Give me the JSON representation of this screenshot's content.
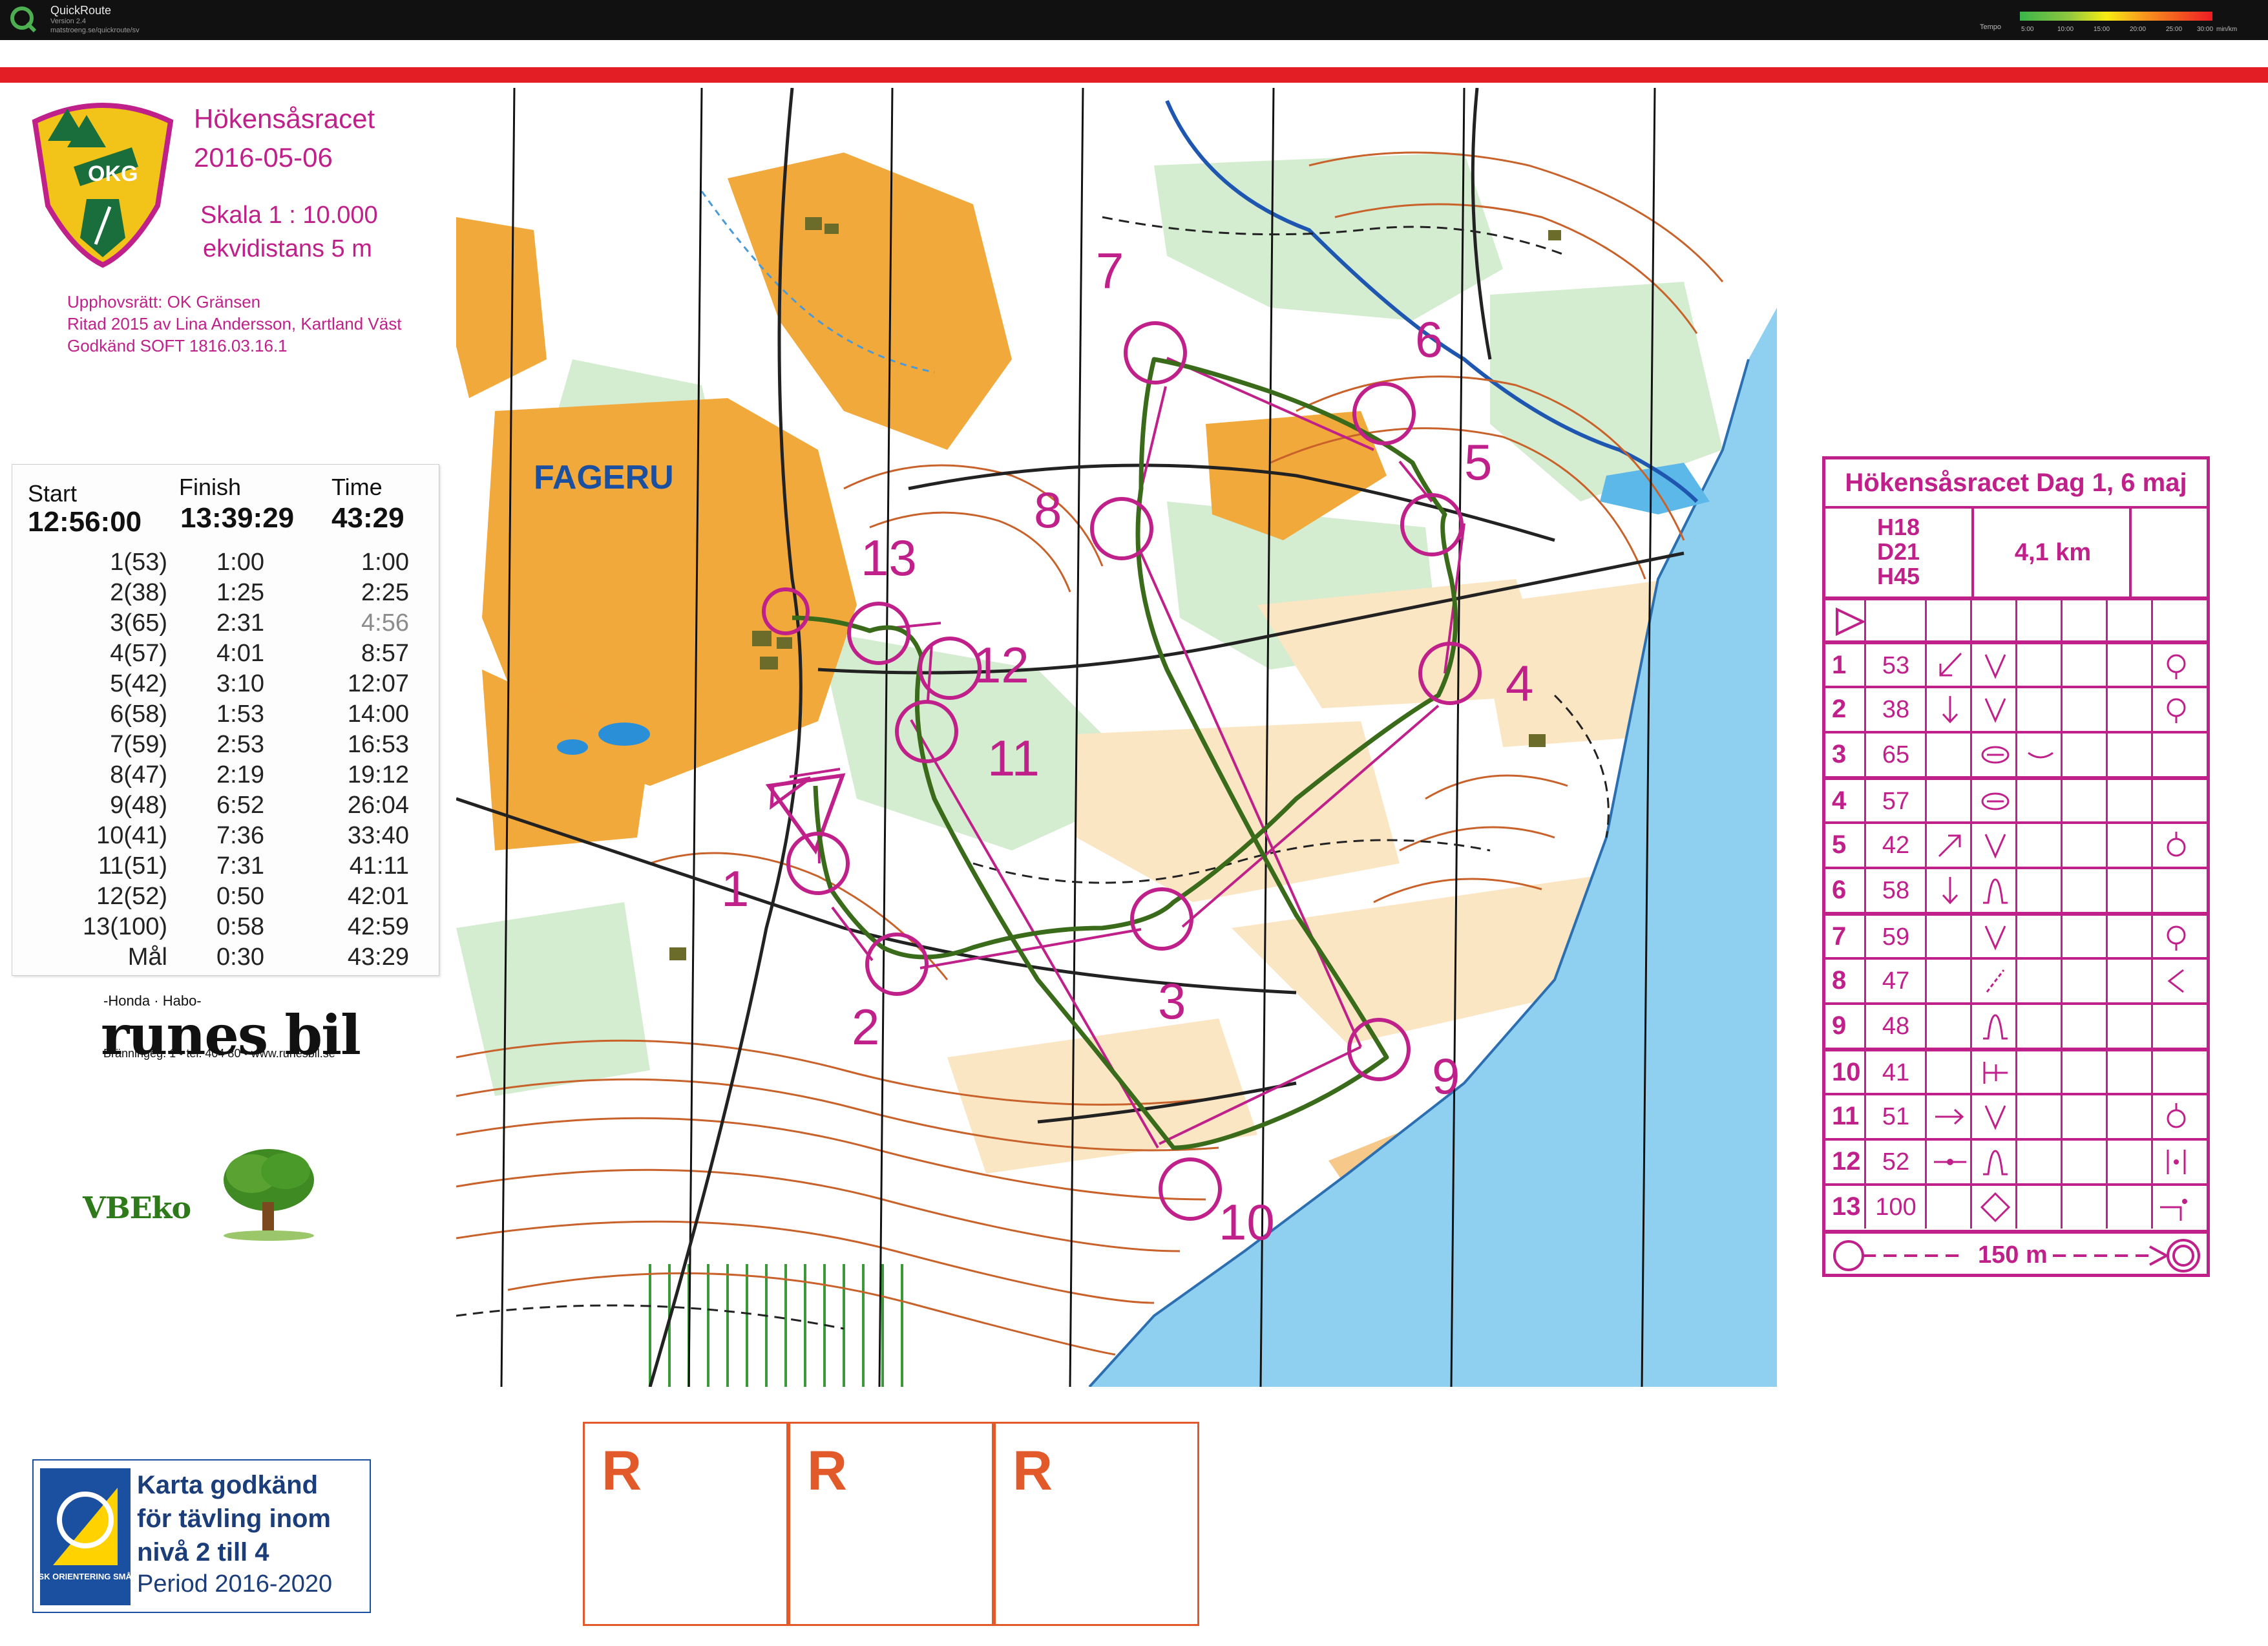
{
  "app": {
    "name": "QuickRoute",
    "version": "Version 2.4",
    "url": "matstroeng.se/quickroute/sv",
    "tempo_label": "Tempo",
    "tempo_ticks": [
      "5:00",
      "10:00",
      "15:00",
      "20:00",
      "25:00",
      "30:00"
    ],
    "tempo_unit": "min/km"
  },
  "header": {
    "club_logo_text": "OKG",
    "event_name": "Hökensåsracet",
    "event_date": "2016-05-06",
    "scale": "Skala 1 : 10.000",
    "contour_interval": "ekvidistans 5 m",
    "credits": [
      "Upphovsrätt: OK Gränsen",
      "Ritad 2015 av Lina Andersson, Kartland Väst",
      "Godkänd SOFT 1816.03.16.1"
    ]
  },
  "split_card": {
    "start_label": "Start",
    "finish_label": "Finish",
    "time_label": "Time",
    "start_time": "12:56:00",
    "finish_time": "13:39:29",
    "total_time": "43:29",
    "rows": [
      {
        "control": "1(53)",
        "leg": "1:00",
        "total": "1:00"
      },
      {
        "control": "2(38)",
        "leg": "1:25",
        "total": "2:25"
      },
      {
        "control": "3(65)",
        "leg": "2:31",
        "total": "4:56"
      },
      {
        "control": "4(57)",
        "leg": "4:01",
        "total": "8:57"
      },
      {
        "control": "5(42)",
        "leg": "3:10",
        "total": "12:07"
      },
      {
        "control": "6(58)",
        "leg": "1:53",
        "total": "14:00"
      },
      {
        "control": "7(59)",
        "leg": "2:53",
        "total": "16:53"
      },
      {
        "control": "8(47)",
        "leg": "2:19",
        "total": "19:12"
      },
      {
        "control": "9(48)",
        "leg": "6:52",
        "total": "26:04"
      },
      {
        "control": "10(41)",
        "leg": "7:36",
        "total": "33:40"
      },
      {
        "control": "11(51)",
        "leg": "7:31",
        "total": "41:11"
      },
      {
        "control": "12(52)",
        "leg": "0:50",
        "total": "42:01"
      },
      {
        "control": "13(100)",
        "leg": "0:58",
        "total": "42:59"
      },
      {
        "control": "Mål",
        "leg": "0:30",
        "total": "43:29"
      }
    ]
  },
  "sponsors": {
    "runes_top": "-Honda · Habo-",
    "runes_name": "runes bil",
    "runes_address": "Bränningeg. 1 • tel. 404 80 • www.runesbil.se",
    "vbeko": "VBEko"
  },
  "approval": {
    "badge_text": "SVENSK ORIENTERING SMÅLAND",
    "lines": [
      "Karta godkänd",
      "för tävling inom",
      "nivå 2 till 4"
    ],
    "period": "Period 2016-2020"
  },
  "map": {
    "area_label": "FAGERU",
    "control_labels": [
      "1",
      "2",
      "3",
      "4",
      "5",
      "6",
      "7",
      "8",
      "9",
      "10",
      "11",
      "12",
      "13"
    ],
    "colors": {
      "course": "#c0208a",
      "route": "#3a6b1a",
      "water": "#8fd0f0",
      "open": "#f0a830",
      "contour": "#c8622a"
    }
  },
  "description_sheet": {
    "title": "Hökensåsracet Dag 1, 6 maj",
    "classes": [
      "H18",
      "D21",
      "H45"
    ],
    "length": "4,1 km",
    "rows": [
      {
        "num": "1",
        "code": "53"
      },
      {
        "num": "2",
        "code": "38"
      },
      {
        "num": "3",
        "code": "65"
      },
      {
        "num": "4",
        "code": "57"
      },
      {
        "num": "5",
        "code": "42"
      },
      {
        "num": "6",
        "code": "58"
      },
      {
        "num": "7",
        "code": "59"
      },
      {
        "num": "8",
        "code": "47"
      },
      {
        "num": "9",
        "code": "48"
      },
      {
        "num": "10",
        "code": "41"
      },
      {
        "num": "11",
        "code": "51"
      },
      {
        "num": "12",
        "code": "52"
      },
      {
        "num": "13",
        "code": "100"
      }
    ],
    "footer": "150 m"
  },
  "punch_boxes": [
    "R",
    "R",
    "R"
  ]
}
